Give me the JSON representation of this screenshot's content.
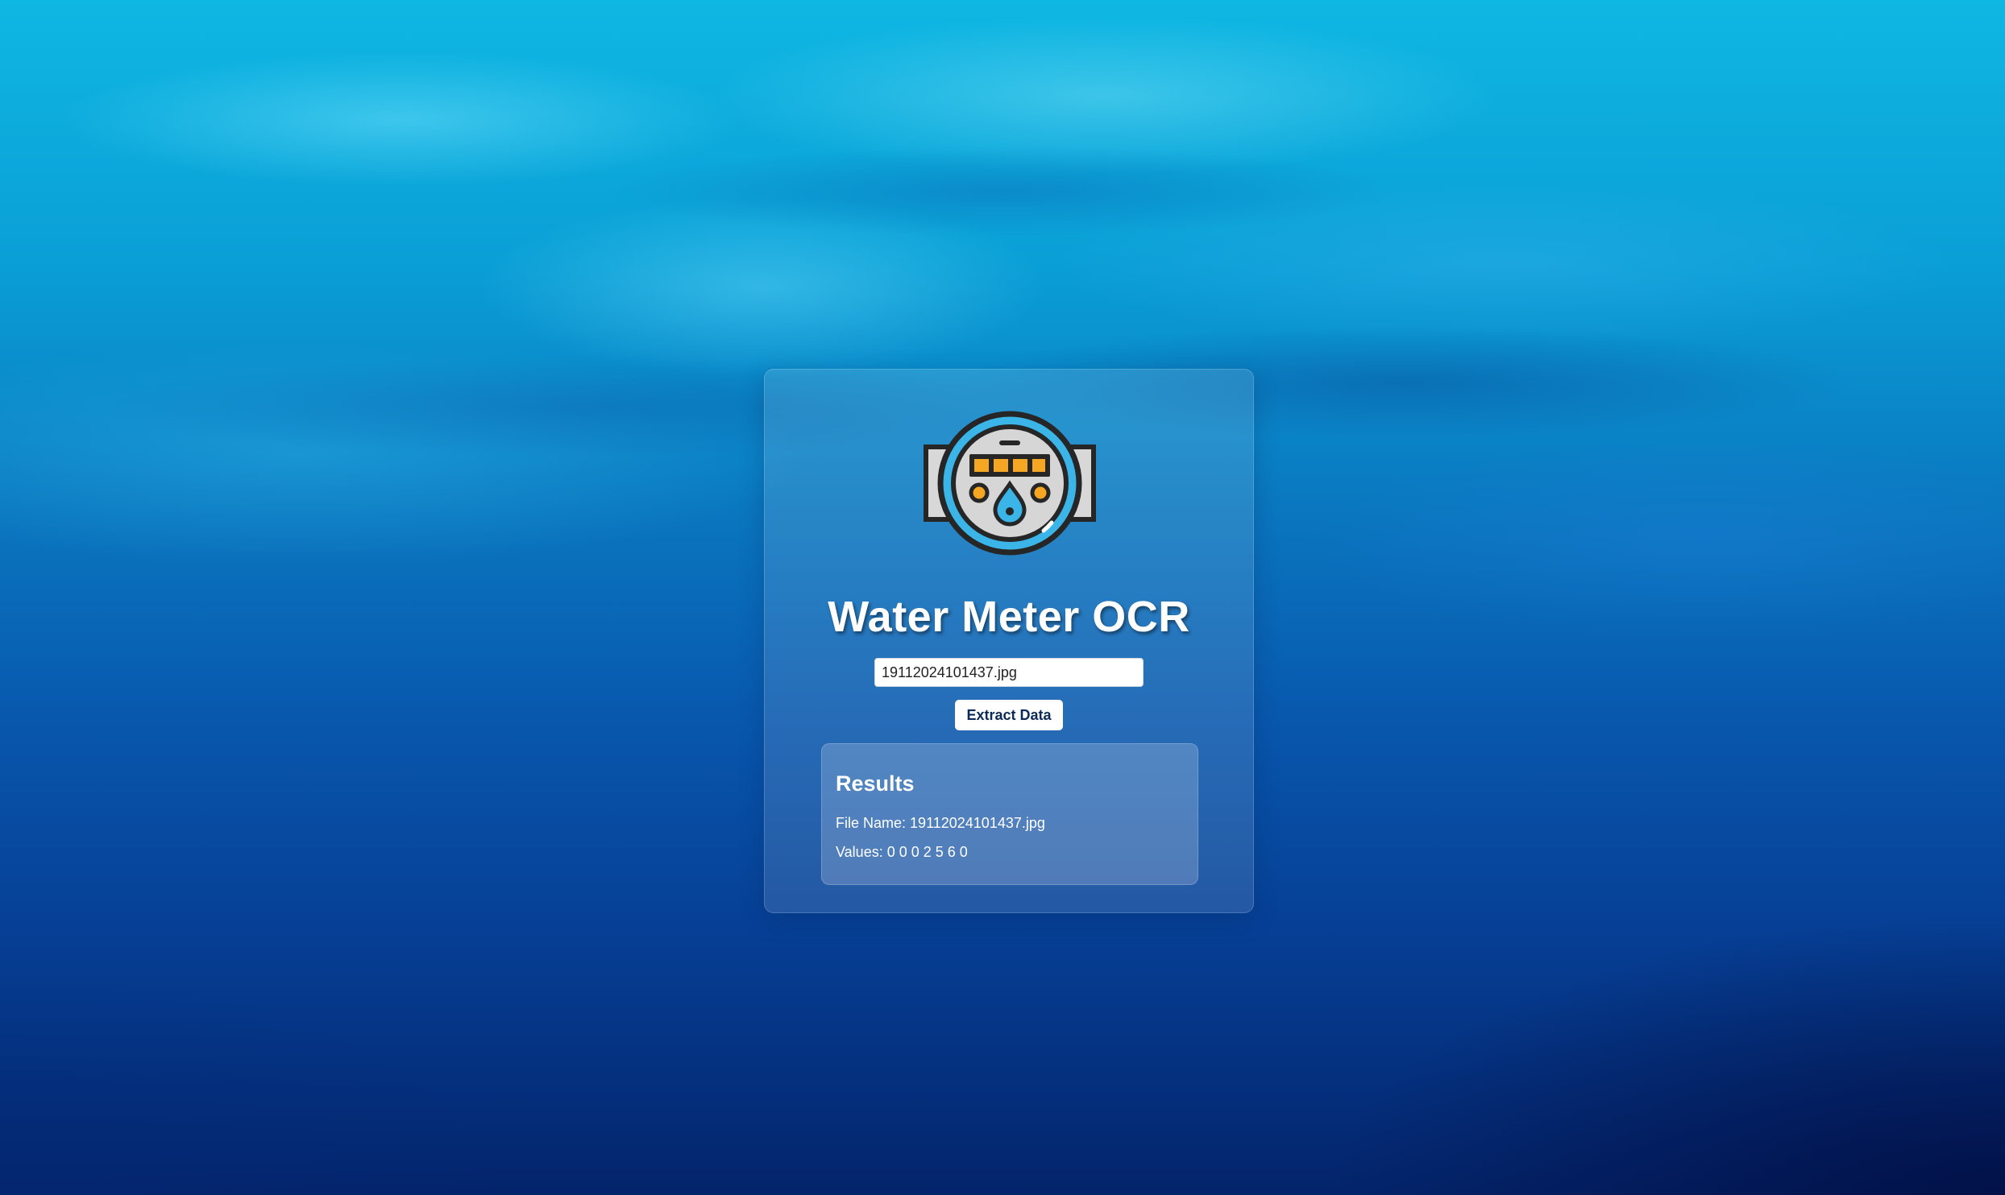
{
  "app": {
    "title": "Water Meter OCR",
    "logo_icon": "water-meter-icon"
  },
  "upload": {
    "file_value": "19112024101437.jpg"
  },
  "actions": {
    "extract_label": "Extract Data"
  },
  "results": {
    "heading": "Results",
    "file_name_label": "File Name:",
    "file_name_value": "19112024101437.jpg",
    "values_label": "Values:",
    "values_value": "0 0 0 2 5 6 0"
  },
  "colors": {
    "accent": "#f5a623",
    "meter_blue": "#3bb4e8",
    "button_text": "#0c2a57"
  }
}
